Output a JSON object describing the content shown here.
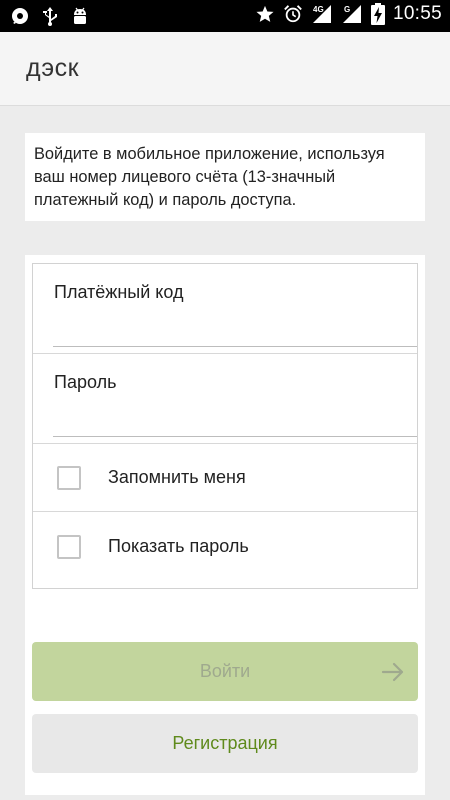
{
  "status_bar": {
    "time": "10:55",
    "left_icons": [
      "chat-notification-icon",
      "usb-icon",
      "android-debug-icon"
    ],
    "right_icons": [
      "star-icon",
      "alarm-icon",
      "signal-4g-icon",
      "signal-g-icon",
      "battery-charging-icon"
    ],
    "network_4g": "4G",
    "network_g": "G"
  },
  "app_bar": {
    "title": "дэск"
  },
  "info": {
    "text": "Войдите в мобильное приложение, используя ваш номер лицевого счёта (13-значный платежный код) и пароль доступа."
  },
  "form": {
    "payment_code_label": "Платёжный код",
    "payment_code_value": "",
    "password_label": "Пароль",
    "password_value": "",
    "remember_label": "Запомнить меня",
    "remember_checked": false,
    "show_password_label": "Показать пароль",
    "show_password_checked": false
  },
  "buttons": {
    "login_label": "Войти",
    "register_label": "Регистрация"
  },
  "colors": {
    "login_button_bg": "#c2d59d",
    "register_text": "#5f8a1c",
    "status_bar_bg": "#000000",
    "app_bar_bg": "#f5f5f5"
  }
}
